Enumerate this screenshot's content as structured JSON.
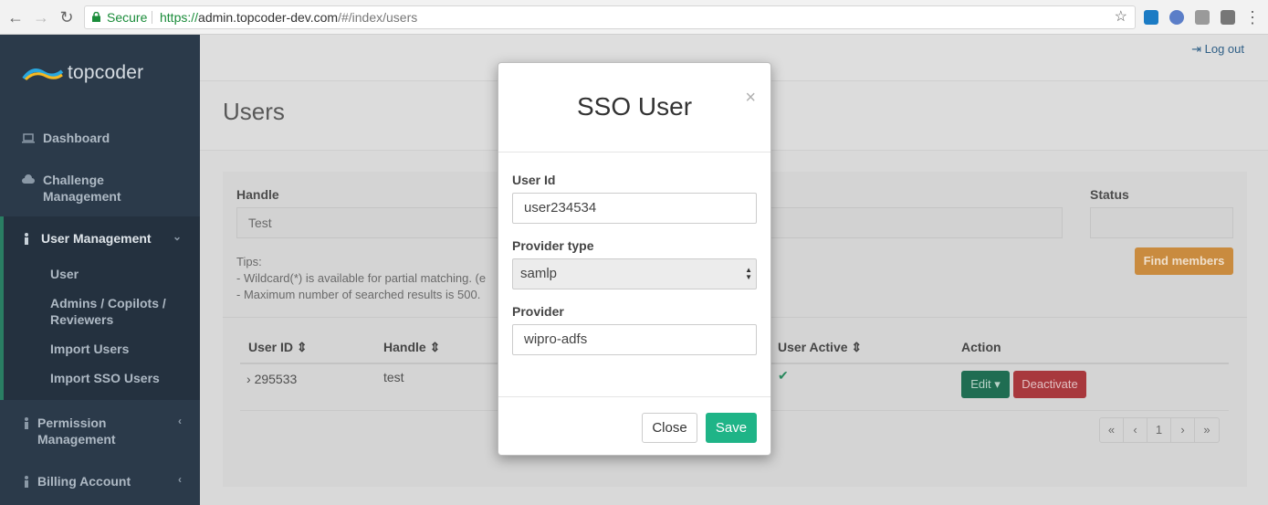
{
  "browser": {
    "secure_label": "Secure",
    "url_scheme": "https://",
    "url_host": "admin.topcoder-dev.com",
    "url_path": "/#/index/users"
  },
  "sidebar": {
    "logo_text": "topcoder",
    "items": [
      {
        "label": "Dashboard"
      },
      {
        "label": "Challenge Management"
      },
      {
        "label": "User Management"
      },
      {
        "label": "Permission Management"
      },
      {
        "label": "Billing Account"
      }
    ],
    "sub_items": [
      {
        "label": "User"
      },
      {
        "label": "Admins / Copilots / Reviewers"
      },
      {
        "label": "Import Users"
      },
      {
        "label": "Import SSO Users"
      }
    ]
  },
  "header": {
    "logout_label": "Log out",
    "page_title": "Users"
  },
  "search": {
    "handle_label": "Handle",
    "handle_value": "Test",
    "status_label": "Status",
    "tips_title": "Tips:",
    "tip_1": "- Wildcard(*) is available for partial matching. (e",
    "tip_2": "- Maximum number of searched results is 500.",
    "find_button": "Find members"
  },
  "table": {
    "columns": [
      "User ID",
      "Handle",
      "User Active",
      "Action"
    ],
    "rows": [
      {
        "user_id": "295533",
        "handle": "test",
        "active": true
      }
    ],
    "edit_label": "Edit",
    "deactivate_label": "Deactivate"
  },
  "pagination": [
    "«",
    "‹",
    "1",
    "›",
    "»"
  ],
  "modal": {
    "title": "SSO User",
    "close_x": "×",
    "user_id_label": "User Id",
    "user_id_value": "user234534",
    "provider_type_label": "Provider type",
    "provider_type_value": "samlp",
    "provider_label": "Provider",
    "provider_value": "wipro-adfs",
    "close_button": "Close",
    "save_button": "Save"
  }
}
